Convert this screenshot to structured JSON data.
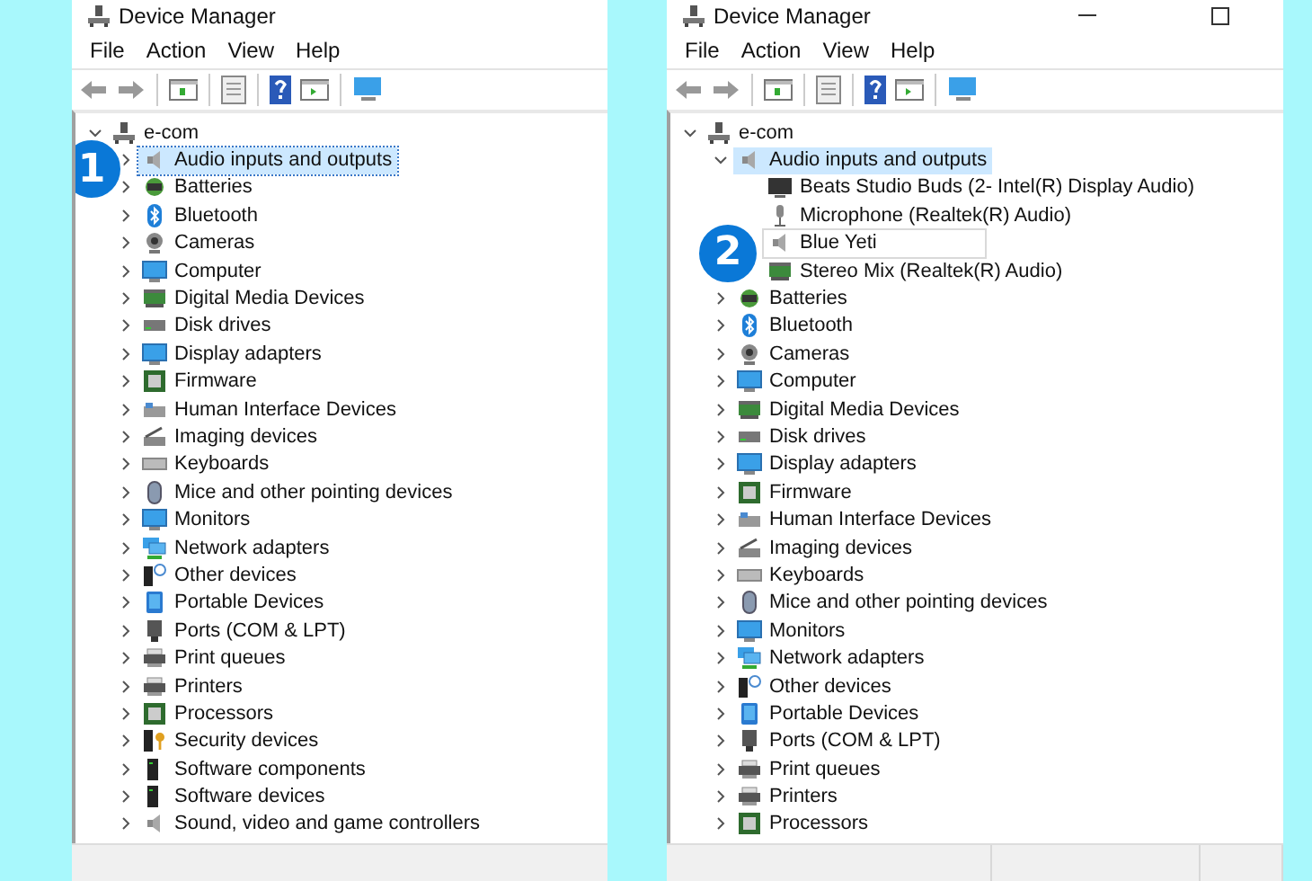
{
  "windows": [
    {
      "title": "Device Manager",
      "window_buttons": false,
      "status_divided": false,
      "menu": [
        "File",
        "Action",
        "View",
        "Help"
      ],
      "tree": {
        "label": "e-com",
        "kind": "pc",
        "expanded": true,
        "selected": false,
        "focused": false,
        "children": [
          {
            "label": "Audio inputs and outputs",
            "kind": "speaker",
            "expanded": false,
            "selected": true,
            "focused": true,
            "callout": "1"
          },
          {
            "label": "Batteries",
            "kind": "battery",
            "expanded": false,
            "selected": false,
            "focused": false
          },
          {
            "label": "Bluetooth",
            "kind": "bluetooth",
            "expanded": false,
            "selected": false,
            "focused": false
          },
          {
            "label": "Cameras",
            "kind": "camera",
            "expanded": false,
            "selected": false,
            "focused": false
          },
          {
            "label": "Computer",
            "kind": "monitor",
            "expanded": false,
            "selected": false,
            "focused": false
          },
          {
            "label": "Digital Media Devices",
            "kind": "media",
            "expanded": false,
            "selected": false,
            "focused": false
          },
          {
            "label": "Disk drives",
            "kind": "disk",
            "expanded": false,
            "selected": false,
            "focused": false
          },
          {
            "label": "Display adapters",
            "kind": "display",
            "expanded": false,
            "selected": false,
            "focused": false
          },
          {
            "label": "Firmware",
            "kind": "chip",
            "expanded": false,
            "selected": false,
            "focused": false
          },
          {
            "label": "Human Interface Devices",
            "kind": "hid",
            "expanded": false,
            "selected": false,
            "focused": false
          },
          {
            "label": "Imaging devices",
            "kind": "imaging",
            "expanded": false,
            "selected": false,
            "focused": false
          },
          {
            "label": "Keyboards",
            "kind": "keyboard",
            "expanded": false,
            "selected": false,
            "focused": false
          },
          {
            "label": "Mice and other pointing devices",
            "kind": "mouse",
            "expanded": false,
            "selected": false,
            "focused": false
          },
          {
            "label": "Monitors",
            "kind": "monitor",
            "expanded": false,
            "selected": false,
            "focused": false
          },
          {
            "label": "Network adapters",
            "kind": "network",
            "expanded": false,
            "selected": false,
            "focused": false
          },
          {
            "label": "Other devices",
            "kind": "other",
            "expanded": false,
            "selected": false,
            "focused": false
          },
          {
            "label": "Portable Devices",
            "kind": "portable",
            "expanded": false,
            "selected": false,
            "focused": false
          },
          {
            "label": "Ports (COM & LPT)",
            "kind": "port",
            "expanded": false,
            "selected": false,
            "focused": false
          },
          {
            "label": "Print queues",
            "kind": "printer",
            "expanded": false,
            "selected": false,
            "focused": false
          },
          {
            "label": "Printers",
            "kind": "printer",
            "expanded": false,
            "selected": false,
            "focused": false
          },
          {
            "label": "Processors",
            "kind": "chip",
            "expanded": false,
            "selected": false,
            "focused": false
          },
          {
            "label": "Security devices",
            "kind": "security",
            "expanded": false,
            "selected": false,
            "focused": false
          },
          {
            "label": "Software components",
            "kind": "software",
            "expanded": false,
            "selected": false,
            "focused": false
          },
          {
            "label": "Software devices",
            "kind": "software",
            "expanded": false,
            "selected": false,
            "focused": false
          },
          {
            "label": "Sound, video and game controllers",
            "kind": "speaker",
            "expanded": false,
            "selected": false,
            "focused": false
          }
        ]
      }
    },
    {
      "title": "Device Manager",
      "window_buttons": true,
      "status_divided": true,
      "menu": [
        "File",
        "Action",
        "View",
        "Help"
      ],
      "tree": {
        "label": "e-com",
        "kind": "pc",
        "expanded": true,
        "selected": false,
        "focused": false,
        "children": [
          {
            "label": "Audio inputs and outputs",
            "kind": "speaker",
            "expanded": true,
            "selected": true,
            "focused": false,
            "children": [
              {
                "label": "Beats Studio Buds (2- Intel(R) Display Audio)",
                "kind": "screen",
                "selected": false,
                "focused": false
              },
              {
                "label": "Microphone (Realtek(R) Audio)",
                "kind": "mic",
                "selected": false,
                "focused": false
              },
              {
                "label": "Blue Yeti",
                "kind": "speaker",
                "selected": false,
                "focused": true,
                "callout": "2"
              },
              {
                "label": "Stereo Mix (Realtek(R) Audio)",
                "kind": "media",
                "selected": false,
                "focused": false
              }
            ]
          },
          {
            "label": "Batteries",
            "kind": "battery",
            "expanded": false,
            "selected": false,
            "focused": false
          },
          {
            "label": "Bluetooth",
            "kind": "bluetooth",
            "expanded": false,
            "selected": false,
            "focused": false
          },
          {
            "label": "Cameras",
            "kind": "camera",
            "expanded": false,
            "selected": false,
            "focused": false
          },
          {
            "label": "Computer",
            "kind": "monitor",
            "expanded": false,
            "selected": false,
            "focused": false
          },
          {
            "label": "Digital Media Devices",
            "kind": "media",
            "expanded": false,
            "selected": false,
            "focused": false
          },
          {
            "label": "Disk drives",
            "kind": "disk",
            "expanded": false,
            "selected": false,
            "focused": false
          },
          {
            "label": "Display adapters",
            "kind": "display",
            "expanded": false,
            "selected": false,
            "focused": false
          },
          {
            "label": "Firmware",
            "kind": "chip",
            "expanded": false,
            "selected": false,
            "focused": false
          },
          {
            "label": "Human Interface Devices",
            "kind": "hid",
            "expanded": false,
            "selected": false,
            "focused": false
          },
          {
            "label": "Imaging devices",
            "kind": "imaging",
            "expanded": false,
            "selected": false,
            "focused": false
          },
          {
            "label": "Keyboards",
            "kind": "keyboard",
            "expanded": false,
            "selected": false,
            "focused": false
          },
          {
            "label": "Mice and other pointing devices",
            "kind": "mouse",
            "expanded": false,
            "selected": false,
            "focused": false
          },
          {
            "label": "Monitors",
            "kind": "monitor",
            "expanded": false,
            "selected": false,
            "focused": false
          },
          {
            "label": "Network adapters",
            "kind": "network",
            "expanded": false,
            "selected": false,
            "focused": false
          },
          {
            "label": "Other devices",
            "kind": "other",
            "expanded": false,
            "selected": false,
            "focused": false
          },
          {
            "label": "Portable Devices",
            "kind": "portable",
            "expanded": false,
            "selected": false,
            "focused": false
          },
          {
            "label": "Ports (COM & LPT)",
            "kind": "port",
            "expanded": false,
            "selected": false,
            "focused": false
          },
          {
            "label": "Print queues",
            "kind": "printer",
            "expanded": false,
            "selected": false,
            "focused": false
          },
          {
            "label": "Printers",
            "kind": "printer",
            "expanded": false,
            "selected": false,
            "focused": false
          },
          {
            "label": "Processors",
            "kind": "chip",
            "expanded": false,
            "selected": false,
            "focused": false
          }
        ]
      }
    }
  ]
}
